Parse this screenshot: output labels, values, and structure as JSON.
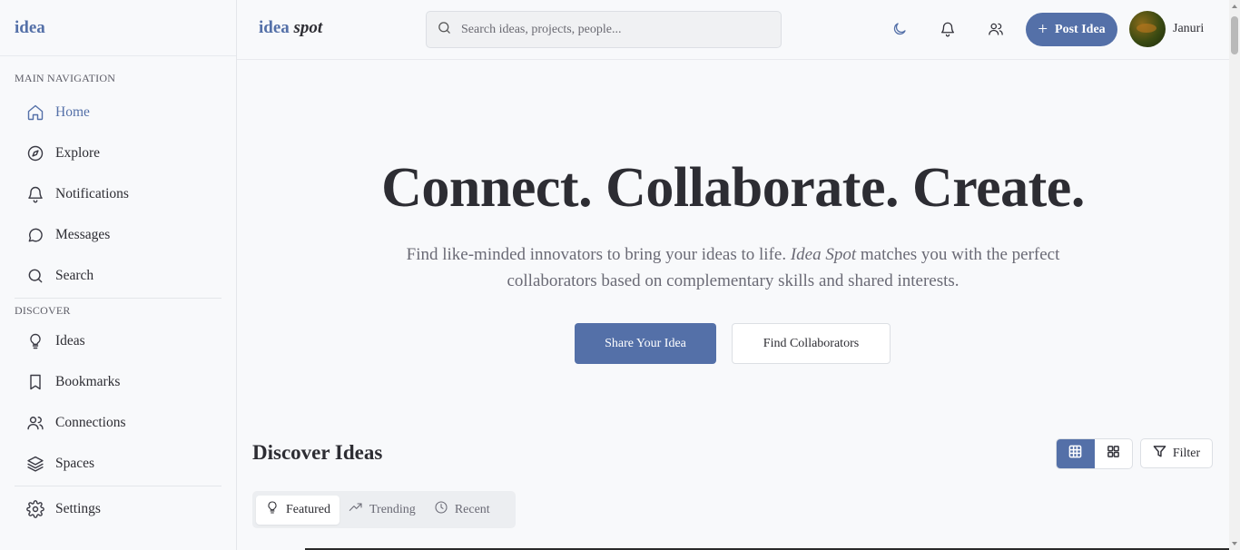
{
  "sidebar": {
    "logo": "idea",
    "main_nav_title": "MAIN NAVIGATION",
    "main_items": [
      {
        "label": "Home",
        "icon": "home-icon"
      },
      {
        "label": "Explore",
        "icon": "compass-icon"
      },
      {
        "label": "Notifications",
        "icon": "bell-icon"
      },
      {
        "label": "Messages",
        "icon": "message-icon"
      },
      {
        "label": "Search",
        "icon": "search-icon"
      }
    ],
    "discover_title": "DISCOVER",
    "discover_items": [
      {
        "label": "Ideas",
        "icon": "lightbulb-icon"
      },
      {
        "label": "Bookmarks",
        "icon": "bookmark-icon"
      },
      {
        "label": "Connections",
        "icon": "users-icon"
      },
      {
        "label": "Spaces",
        "icon": "layers-icon"
      }
    ],
    "settings_label": "Settings"
  },
  "header": {
    "brand_main": "idea",
    "brand_italic": "spot",
    "search_placeholder": "Search ideas, projects, people...",
    "post_button": "Post Idea",
    "username": "Januri"
  },
  "hero": {
    "title": "Connect. Collaborate. Create.",
    "subtitle_before": "Find like-minded innovators to bring your ideas to life. ",
    "subtitle_italic": "Idea Spot",
    "subtitle_after": " matches you with the perfect collaborators based on complementary skills and shared interests.",
    "primary_button": "Share Your Idea",
    "secondary_button": "Find Collaborators"
  },
  "discover": {
    "title": "Discover Ideas",
    "filter_label": "Filter",
    "tabs": [
      {
        "label": "Featured",
        "icon": "lightbulb-icon",
        "active": true
      },
      {
        "label": "Trending",
        "icon": "trending-icon",
        "active": false
      },
      {
        "label": "Recent",
        "icon": "clock-icon",
        "active": false
      }
    ]
  },
  "colors": {
    "accent": "#5470a8",
    "text": "#2d2d33",
    "muted": "#6a6a75",
    "background": "#f8f9fb"
  }
}
